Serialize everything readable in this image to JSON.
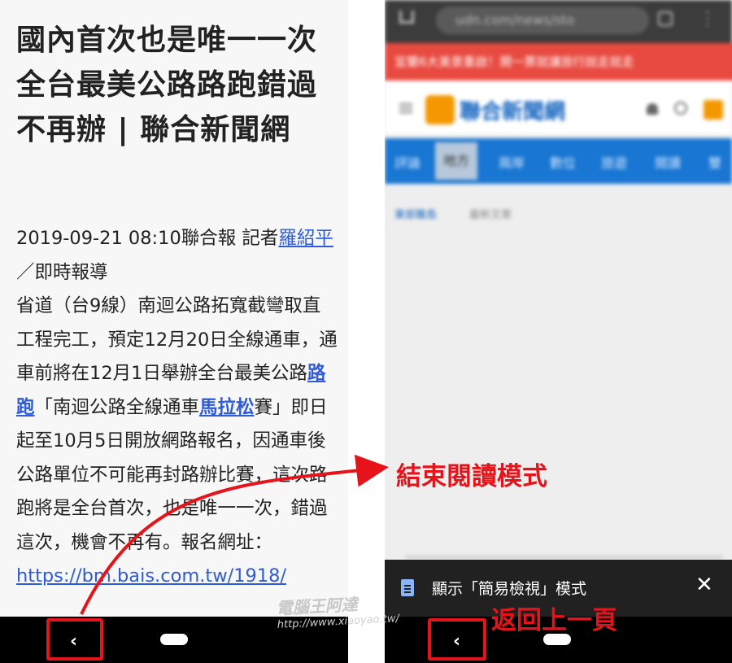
{
  "reader": {
    "title": "國內首次也是唯一一次 全台最美公路路跑錯過不再辦 | 聯合新聞網",
    "date_line": "2019-09-21 08:10聯合報 記者",
    "reporter_link": "羅紹平",
    "report_type": "／即時報導",
    "p1": "省道（台9線）南迴公路拓寬截彎取直工程完工，預定12月20日全線通車，通車前將在12月1日舉辦全台最美公路",
    "link_road_run": "路跑",
    "p2": "「南迴公路全線通車",
    "link_marathon": "馬拉松",
    "p3": "賽」即日起至10月5日開放網路報名，因通車後公路單位不可能再封路辦比賽，這次路跑將是全台首次，也是唯一一次，錯過這次，機會不再有。報名網址：",
    "link_url": "https://bm.bais.com.tw/1918/"
  },
  "browser": {
    "url": "udn.com/news/sto",
    "banner_text": "宜蘭6大美景重啟！開一票就讓旅行說走就走",
    "site_logo": "聯合新聞網",
    "nav_tabs": [
      "評論",
      "地方",
      "兩岸",
      "數位",
      "旅遊",
      "閱讀",
      "雙"
    ],
    "active_tab": "地方",
    "crumb_primary": "東部離島",
    "crumb_secondary": "最新文章"
  },
  "simple_view_bar": {
    "text": "顯示「簡易檢視」模式",
    "close_glyph": "✕"
  },
  "nav": {
    "back_glyph": "‹"
  },
  "annotations": {
    "exit_reader": "結束閱讀模式",
    "go_back": "返回上一頁"
  },
  "watermark": {
    "title": "電腦王阿達",
    "url": "http://www.xiaoyao.tw/"
  },
  "colors": {
    "annotation_red": "#e6141a",
    "link_blue": "#2f5bd6",
    "udn_blue": "#1976d2",
    "udn_orange": "#f39800"
  }
}
